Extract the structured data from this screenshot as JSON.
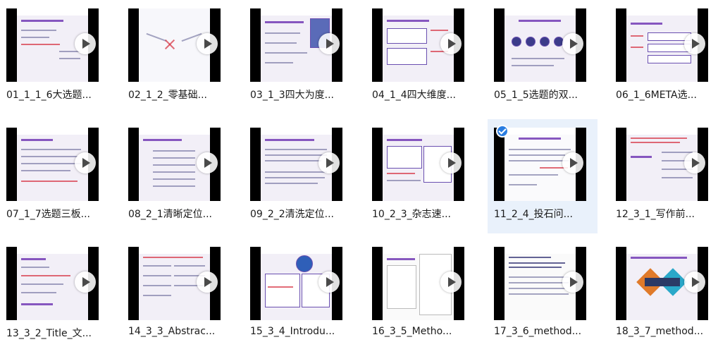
{
  "videos": [
    {
      "label": "01_1_1_6大选题..."
    },
    {
      "label": "02_1_2_零基础..."
    },
    {
      "label": "03_1_3四大为度..."
    },
    {
      "label": "04_1_4四大维度..."
    },
    {
      "label": "05_1_5选题的双..."
    },
    {
      "label": "06_1_6META选..."
    },
    {
      "label": "07_1_7选题三板..."
    },
    {
      "label": "08_2_1清晰定位..."
    },
    {
      "label": "09_2_2清洗定位..."
    },
    {
      "label": "10_2_3_杂志速..."
    },
    {
      "label": "11_2_4_投石问..."
    },
    {
      "label": "12_3_1_写作前..."
    },
    {
      "label": "13_3_2_Title_文..."
    },
    {
      "label": "14_3_3_Abstrac..."
    },
    {
      "label": "15_3_4_Introdu..."
    },
    {
      "label": "16_3_5_Metho..."
    },
    {
      "label": "17_3_6_method..."
    },
    {
      "label": "18_3_7_method..."
    }
  ],
  "selected_index": 10,
  "icons": {
    "play": "play-icon",
    "check": "checkmark-icon"
  },
  "colors": {
    "selected_bg": "#e9f1fb",
    "check_blue": "#2a7de1",
    "slide_accent": "#6a2fb0"
  }
}
